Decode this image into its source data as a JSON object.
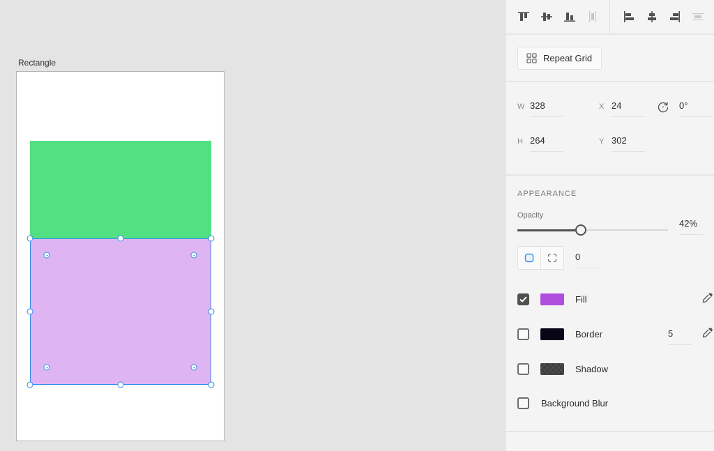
{
  "canvas": {
    "artboard_label": "Rectangle",
    "shapes": [
      {
        "name": "green-rectangle",
        "fill": "#53e083"
      },
      {
        "name": "purple-rectangle",
        "fill": "#b04fdf",
        "opacity_percent": 42
      }
    ],
    "selection_color": "#2d8ceb"
  },
  "panel": {
    "align_icons": [
      "align-top-icon",
      "align-middle-icon",
      "align-bottom-icon",
      "distribute-vertical-icon",
      "align-left-icon",
      "align-center-icon",
      "align-right-icon",
      "distribute-horizontal-icon"
    ],
    "repeat_grid": {
      "icon": "grid-icon",
      "label": "Repeat Grid"
    },
    "geometry": {
      "w_label": "W",
      "w": "328",
      "h_label": "H",
      "h": "264",
      "x_label": "X",
      "x": "24",
      "y_label": "Y",
      "y": "302",
      "rotation_icon": "rotate-icon",
      "rotation": "0°"
    },
    "appearance": {
      "title": "APPEARANCE",
      "opacity_label": "Opacity",
      "opacity_value": "42%",
      "opacity_fraction": 0.42,
      "corner_radius": "0",
      "corner_modes": [
        "uniform-corners-icon",
        "per-corner-icon"
      ],
      "fill": {
        "label": "Fill",
        "checked": true,
        "color": "#b04fdf"
      },
      "border": {
        "label": "Border",
        "checked": false,
        "color": "#080518",
        "size": "5"
      },
      "shadow": {
        "label": "Shadow",
        "checked": false
      },
      "background_blur": {
        "label": "Background Blur",
        "checked": false
      }
    }
  }
}
